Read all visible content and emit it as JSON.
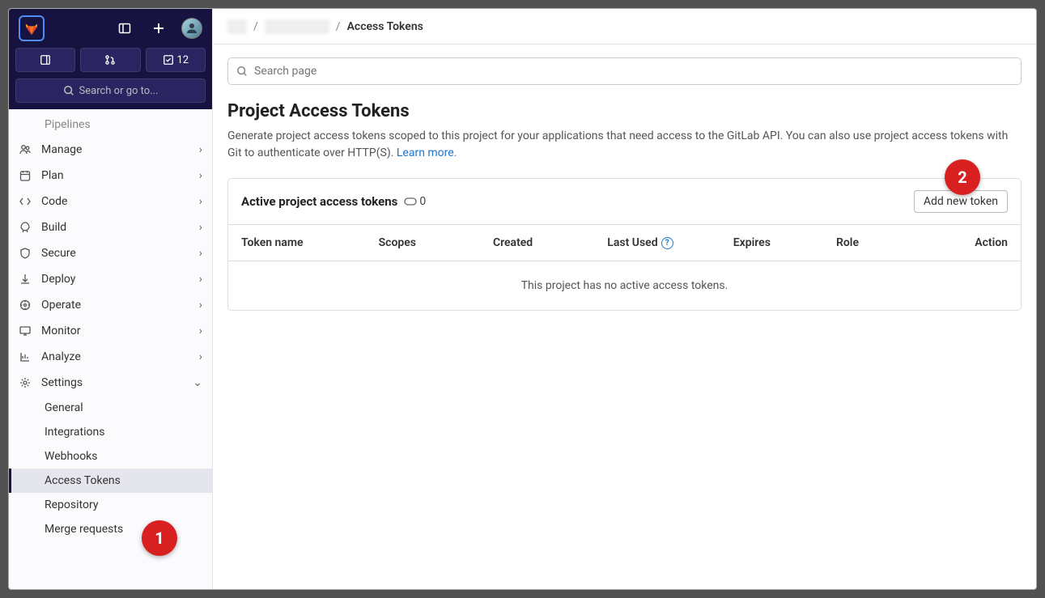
{
  "header": {
    "todo_count": "12",
    "search_placeholder": "Search or go to..."
  },
  "breadcrumb": {
    "current": "Access Tokens"
  },
  "sidebar": {
    "faded": "Pipelines",
    "items": [
      {
        "label": "Manage"
      },
      {
        "label": "Plan"
      },
      {
        "label": "Code"
      },
      {
        "label": "Build"
      },
      {
        "label": "Secure"
      },
      {
        "label": "Deploy"
      },
      {
        "label": "Operate"
      },
      {
        "label": "Monitor"
      },
      {
        "label": "Analyze"
      },
      {
        "label": "Settings"
      }
    ],
    "subs": [
      {
        "label": "General"
      },
      {
        "label": "Integrations"
      },
      {
        "label": "Webhooks"
      },
      {
        "label": "Access Tokens"
      },
      {
        "label": "Repository"
      },
      {
        "label": "Merge requests"
      }
    ]
  },
  "page": {
    "search_placeholder": "Search page",
    "title": "Project Access Tokens",
    "desc": "Generate project access tokens scoped to this project for your applications that need access to the GitLab API. You can also use project access tokens with Git to authenticate over HTTP(S). ",
    "learn_more": "Learn more."
  },
  "card": {
    "title": "Active project access tokens",
    "count": "0",
    "add_btn": "Add new token",
    "empty": "This project has no active access tokens.",
    "cols": {
      "name": "Token name",
      "scopes": "Scopes",
      "created": "Created",
      "lastused": "Last Used",
      "expires": "Expires",
      "role": "Role",
      "action": "Action"
    }
  },
  "callouts": {
    "c1": "1",
    "c2": "2"
  }
}
